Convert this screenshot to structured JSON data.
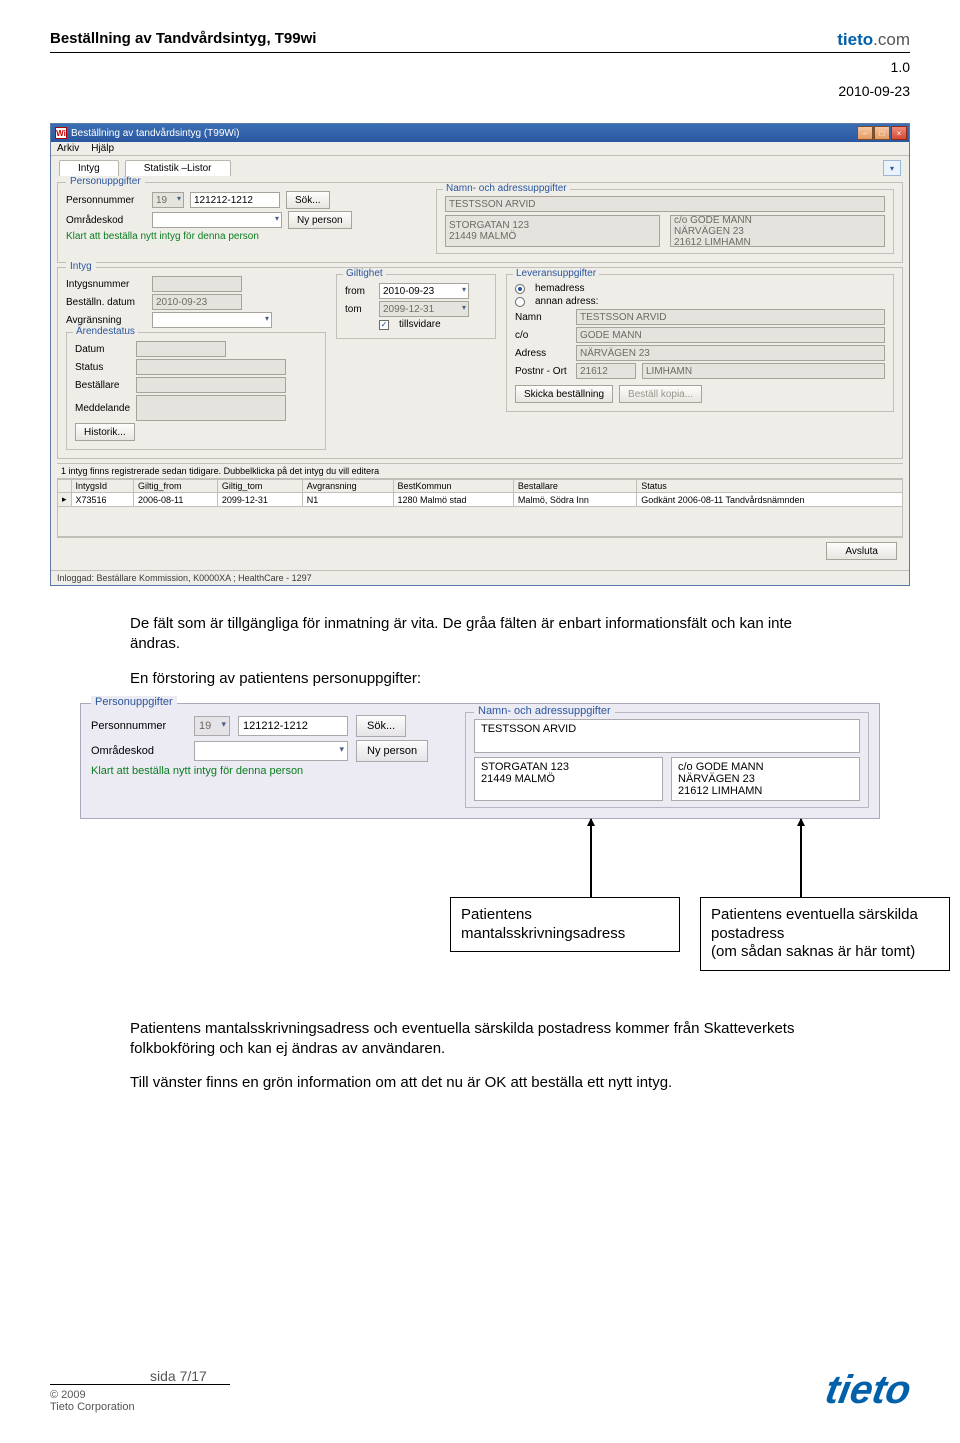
{
  "doc": {
    "title": "Beställning av Tandvårdsintyg, T99wi",
    "logo_brand": "tieto",
    "logo_suffix": ".com",
    "version": "1.0",
    "date": "2010-09-23"
  },
  "app": {
    "window_title": "Beställning av tandvårdsintyg (T99Wi)",
    "menu": {
      "arkiv": "Arkiv",
      "hjalp": "Hjälp"
    },
    "tabs": {
      "intyg": "Intyg",
      "statistik": "Statistik –Listor"
    },
    "person": {
      "legend": "Personuppgifter",
      "personnummer_label": "Personnummer",
      "century": "19",
      "pnr": "121212-1212",
      "sok": "Sök...",
      "omradeskod_label": "Områdeskod",
      "ny_person": "Ny person",
      "status_msg": "Klart att beställa nytt intyg för denna person",
      "addr_legend": "Namn- och adressuppgifter",
      "name": "TESTSSON ARVID",
      "addr1_line1": "STORGATAN 123",
      "addr1_line2": "21449 MALMÖ",
      "addr2_line1": "c/o GODE MANN",
      "addr2_line2": "NÄRVÄGEN 23",
      "addr2_line3": "21612 LIMHAMN"
    },
    "intyg": {
      "legend": "Intyg",
      "intygsnummer": "Intygsnummer",
      "bestalln_datum": "Beställn. datum",
      "bestalln_datum_val": "2010-09-23",
      "avgransning": "Avgränsning",
      "arende_legend": "Ärendestatus",
      "datum": "Datum",
      "status": "Status",
      "bestallare": "Beställare",
      "meddelande": "Meddelande",
      "historik": "Historik...",
      "gilt_legend": "Giltighet",
      "from": "from",
      "from_val": "2010-09-23",
      "tom": "tom",
      "tom_val": "2099-12-31",
      "tillsvidare": "tillsvidare",
      "lev_legend": "Leveransuppgifter",
      "hemadress": "hemadress",
      "annan": "annan adress:",
      "namn": "Namn",
      "namn_val": "TESTSSON ARVID",
      "co": "c/o",
      "co_val": "GODE MANN",
      "adress": "Adress",
      "adress_val": "NÄRVÄGEN 23",
      "postnr": "Postnr - Ort",
      "postnr_val": "21612",
      "ort_val": "LIMHAMN",
      "skicka": "Skicka beställning",
      "kopia": "Beställ kopia..."
    },
    "grid": {
      "hint": "1 intyg finns registrerade sedan tidigare. Dubbelklicka på det intyg du vill editera",
      "headers": [
        "IntygsId",
        "Giltig_from",
        "Giltig_tom",
        "Avgransning",
        "BestKommun",
        "Bestallare",
        "Status"
      ],
      "row": [
        "X73516",
        "2006-08-11",
        "2099-12-31",
        "N1",
        "1280 Malmö stad",
        "Malmö, Södra Inn",
        "Godkänt 2006-08-11 Tandvårdsnämnden"
      ]
    },
    "avsluta": "Avsluta",
    "statusbar": "Inloggad:  Beställare Kommission, K0000XA ; HealthCare - 1297"
  },
  "body": {
    "p1a": "De fält som är tillgängliga för inmatning är vita. De gråa fälten är enbart informationsfält och kan inte ändras.",
    "p2": "En förstoring av patientens personuppgifter:"
  },
  "enlarge": {
    "legend": "Personuppgifter",
    "personnummer_label": "Personnummer",
    "century": "19",
    "pnr": "121212-1212",
    "sok": "Sök...",
    "omradeskod_label": "Områdeskod",
    "ny_person": "Ny person",
    "status_msg": "Klart att beställa nytt intyg för denna person",
    "addr_legend": "Namn- och adressuppgifter",
    "name": "TESTSSON ARVID",
    "a1l1": "STORGATAN 123",
    "a1l2": "21449 MALMÖ",
    "a2l1": "c/o GODE MANN",
    "a2l2": "NÄRVÄGEN 23",
    "a2l3": "21612 LIMHAMN"
  },
  "callouts": {
    "left": "Patientens mantalsskrivningsadress",
    "right1": "Patientens eventuella särskilda postadress",
    "right2": "(om sådan saknas är här tomt)"
  },
  "body2": {
    "p3": "Patientens mantalsskrivningsadress och eventuella särskilda postadress kommer från Skatteverkets folkbokföring och kan ej ändras av användaren.",
    "p4": "Till vänster finns en grön information om att det nu är OK att beställa ett nytt intyg."
  },
  "footer": {
    "page": "sida 7/17",
    "copyright": "© 2009",
    "corp": "Tieto Corporation",
    "logo": "tieto"
  }
}
